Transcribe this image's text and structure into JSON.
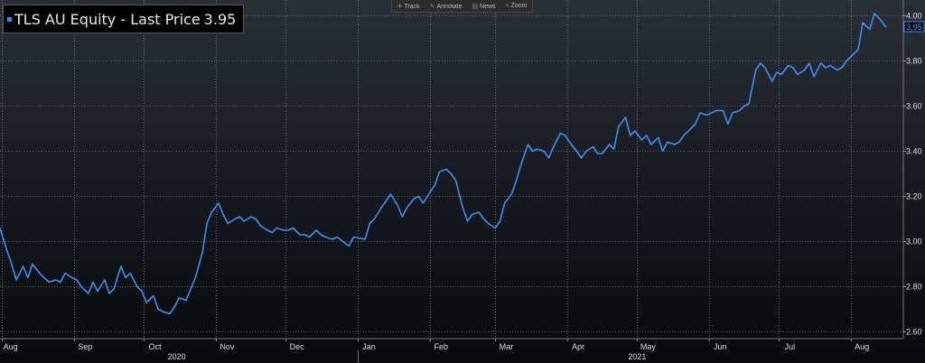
{
  "title": {
    "ticker": "TLS AU Equity",
    "separator": " - ",
    "label": "Last Price",
    "value": "3.95"
  },
  "toolbar": {
    "track": "Track",
    "annotate": "Annotate",
    "news": "News",
    "zoom": "Zoom"
  },
  "colors": {
    "line": "#3d8ff2",
    "badge": "#2f8fff",
    "grid": "#9aa0a8"
  },
  "chart_data": {
    "type": "line",
    "title": "TLS AU Equity - Last Price 3.95",
    "ylim": [
      2.57,
      4.07
    ],
    "yticks": [
      "4.00",
      "3.80",
      "3.60",
      "3.40",
      "3.20",
      "3.00",
      "2.80",
      "2.60"
    ],
    "ytick_values": [
      4.0,
      3.8,
      3.6,
      3.4,
      3.2,
      3.0,
      2.8,
      2.6
    ],
    "last_value_label": "3.95",
    "grid": true,
    "x_months": [
      "Aug",
      "Sep",
      "Oct",
      "Nov",
      "Dec",
      "Jan",
      "Feb",
      "Mar",
      "Apr",
      "May",
      "Jun",
      "Jul",
      "Aug"
    ],
    "x_years": [
      "2020",
      "2021"
    ],
    "x_domain": [
      "2020-07-31",
      "2021-08-18"
    ],
    "month_ticks": [
      "2020-08-01",
      "2020-09-01",
      "2020-10-01",
      "2020-11-01",
      "2020-12-01",
      "2021-01-01",
      "2021-02-01",
      "2021-03-01",
      "2021-04-01",
      "2021-05-01",
      "2021-06-01",
      "2021-07-01",
      "2021-08-01"
    ],
    "year_ticks": [
      "2020-10-15",
      "2021-05-01"
    ],
    "year_divider": "2021-01-01",
    "series": [
      {
        "values": [
          [
            "2020-07-31",
            3.06
          ],
          [
            "2020-08-03",
            2.96
          ],
          [
            "2020-08-05",
            2.9
          ],
          [
            "2020-08-07",
            2.83
          ],
          [
            "2020-08-10",
            2.89
          ],
          [
            "2020-08-12",
            2.84
          ],
          [
            "2020-08-14",
            2.9
          ],
          [
            "2020-08-17",
            2.86
          ],
          [
            "2020-08-19",
            2.84
          ],
          [
            "2020-08-21",
            2.82
          ],
          [
            "2020-08-24",
            2.83
          ],
          [
            "2020-08-26",
            2.82
          ],
          [
            "2020-08-28",
            2.86
          ],
          [
            "2020-08-31",
            2.84
          ],
          [
            "2020-09-02",
            2.83
          ],
          [
            "2020-09-04",
            2.8
          ],
          [
            "2020-09-07",
            2.77
          ],
          [
            "2020-09-09",
            2.82
          ],
          [
            "2020-09-11",
            2.78
          ],
          [
            "2020-09-14",
            2.83
          ],
          [
            "2020-09-16",
            2.77
          ],
          [
            "2020-09-18",
            2.79
          ],
          [
            "2020-09-21",
            2.89
          ],
          [
            "2020-09-23",
            2.84
          ],
          [
            "2020-09-25",
            2.86
          ],
          [
            "2020-09-28",
            2.8
          ],
          [
            "2020-09-30",
            2.78
          ],
          [
            "2020-10-02",
            2.73
          ],
          [
            "2020-10-05",
            2.76
          ],
          [
            "2020-10-07",
            2.7
          ],
          [
            "2020-10-09",
            2.69
          ],
          [
            "2020-10-12",
            2.68
          ],
          [
            "2020-10-14",
            2.71
          ],
          [
            "2020-10-16",
            2.75
          ],
          [
            "2020-10-19",
            2.74
          ],
          [
            "2020-10-21",
            2.79
          ],
          [
            "2020-10-23",
            2.84
          ],
          [
            "2020-10-26",
            2.95
          ],
          [
            "2020-10-28",
            3.08
          ],
          [
            "2020-10-30",
            3.13
          ],
          [
            "2020-11-02",
            3.17
          ],
          [
            "2020-11-04",
            3.12
          ],
          [
            "2020-11-06",
            3.08
          ],
          [
            "2020-11-09",
            3.1
          ],
          [
            "2020-11-11",
            3.11
          ],
          [
            "2020-11-13",
            3.09
          ],
          [
            "2020-11-16",
            3.11
          ],
          [
            "2020-11-18",
            3.1
          ],
          [
            "2020-11-20",
            3.07
          ],
          [
            "2020-11-23",
            3.05
          ],
          [
            "2020-11-25",
            3.04
          ],
          [
            "2020-11-27",
            3.06
          ],
          [
            "2020-11-30",
            3.05
          ],
          [
            "2020-12-02",
            3.05
          ],
          [
            "2020-12-04",
            3.06
          ],
          [
            "2020-12-07",
            3.03
          ],
          [
            "2020-12-09",
            3.03
          ],
          [
            "2020-12-11",
            3.02
          ],
          [
            "2020-12-14",
            3.05
          ],
          [
            "2020-12-16",
            3.03
          ],
          [
            "2020-12-18",
            3.02
          ],
          [
            "2020-12-21",
            3.01
          ],
          [
            "2020-12-23",
            3.02
          ],
          [
            "2020-12-28",
            2.98
          ],
          [
            "2020-12-30",
            3.02
          ],
          [
            "2021-01-04",
            3.01
          ],
          [
            "2021-01-06",
            3.08
          ],
          [
            "2021-01-08",
            3.1
          ],
          [
            "2021-01-11",
            3.15
          ],
          [
            "2021-01-13",
            3.18
          ],
          [
            "2021-01-15",
            3.21
          ],
          [
            "2021-01-18",
            3.16
          ],
          [
            "2021-01-20",
            3.11
          ],
          [
            "2021-01-22",
            3.15
          ],
          [
            "2021-01-25",
            3.19
          ],
          [
            "2021-01-27",
            3.2
          ],
          [
            "2021-01-29",
            3.17
          ],
          [
            "2021-02-01",
            3.22
          ],
          [
            "2021-02-03",
            3.25
          ],
          [
            "2021-02-05",
            3.31
          ],
          [
            "2021-02-08",
            3.32
          ],
          [
            "2021-02-10",
            3.3
          ],
          [
            "2021-02-12",
            3.27
          ],
          [
            "2021-02-15",
            3.15
          ],
          [
            "2021-02-17",
            3.09
          ],
          [
            "2021-02-19",
            3.12
          ],
          [
            "2021-02-22",
            3.13
          ],
          [
            "2021-02-24",
            3.1
          ],
          [
            "2021-02-26",
            3.08
          ],
          [
            "2021-03-01",
            3.06
          ],
          [
            "2021-03-03",
            3.09
          ],
          [
            "2021-03-05",
            3.17
          ],
          [
            "2021-03-08",
            3.21
          ],
          [
            "2021-03-10",
            3.27
          ],
          [
            "2021-03-12",
            3.34
          ],
          [
            "2021-03-15",
            3.43
          ],
          [
            "2021-03-17",
            3.4
          ],
          [
            "2021-03-19",
            3.41
          ],
          [
            "2021-03-22",
            3.4
          ],
          [
            "2021-03-24",
            3.37
          ],
          [
            "2021-03-26",
            3.42
          ],
          [
            "2021-03-29",
            3.48
          ],
          [
            "2021-03-31",
            3.47
          ],
          [
            "2021-04-02",
            3.44
          ],
          [
            "2021-04-05",
            3.4
          ],
          [
            "2021-04-07",
            3.37
          ],
          [
            "2021-04-09",
            3.4
          ],
          [
            "2021-04-12",
            3.42
          ],
          [
            "2021-04-14",
            3.39
          ],
          [
            "2021-04-16",
            3.39
          ],
          [
            "2021-04-19",
            3.43
          ],
          [
            "2021-04-21",
            3.41
          ],
          [
            "2021-04-23",
            3.51
          ],
          [
            "2021-04-26",
            3.55
          ],
          [
            "2021-04-28",
            3.47
          ],
          [
            "2021-04-30",
            3.49
          ],
          [
            "2021-05-03",
            3.45
          ],
          [
            "2021-05-05",
            3.47
          ],
          [
            "2021-05-07",
            3.43
          ],
          [
            "2021-05-10",
            3.46
          ],
          [
            "2021-05-12",
            3.4
          ],
          [
            "2021-05-14",
            3.44
          ],
          [
            "2021-05-17",
            3.43
          ],
          [
            "2021-05-19",
            3.44
          ],
          [
            "2021-05-21",
            3.47
          ],
          [
            "2021-05-24",
            3.5
          ],
          [
            "2021-05-26",
            3.52
          ],
          [
            "2021-05-28",
            3.57
          ],
          [
            "2021-05-31",
            3.56
          ],
          [
            "2021-06-02",
            3.57
          ],
          [
            "2021-06-04",
            3.58
          ],
          [
            "2021-06-07",
            3.58
          ],
          [
            "2021-06-09",
            3.52
          ],
          [
            "2021-06-11",
            3.57
          ],
          [
            "2021-06-14",
            3.58
          ],
          [
            "2021-06-16",
            3.6
          ],
          [
            "2021-06-18",
            3.61
          ],
          [
            "2021-06-21",
            3.76
          ],
          [
            "2021-06-23",
            3.79
          ],
          [
            "2021-06-25",
            3.77
          ],
          [
            "2021-06-28",
            3.71
          ],
          [
            "2021-06-30",
            3.75
          ],
          [
            "2021-07-02",
            3.74
          ],
          [
            "2021-07-05",
            3.78
          ],
          [
            "2021-07-07",
            3.77
          ],
          [
            "2021-07-09",
            3.74
          ],
          [
            "2021-07-12",
            3.76
          ],
          [
            "2021-07-14",
            3.79
          ],
          [
            "2021-07-16",
            3.73
          ],
          [
            "2021-07-19",
            3.79
          ],
          [
            "2021-07-21",
            3.77
          ],
          [
            "2021-07-23",
            3.78
          ],
          [
            "2021-07-26",
            3.76
          ],
          [
            "2021-07-28",
            3.77
          ],
          [
            "2021-07-30",
            3.8
          ],
          [
            "2021-08-02",
            3.83
          ],
          [
            "2021-08-04",
            3.85
          ],
          [
            "2021-08-06",
            3.97
          ],
          [
            "2021-08-09",
            3.94
          ],
          [
            "2021-08-11",
            4.01
          ],
          [
            "2021-08-13",
            3.99
          ],
          [
            "2021-08-16",
            3.95
          ]
        ]
      }
    ]
  }
}
